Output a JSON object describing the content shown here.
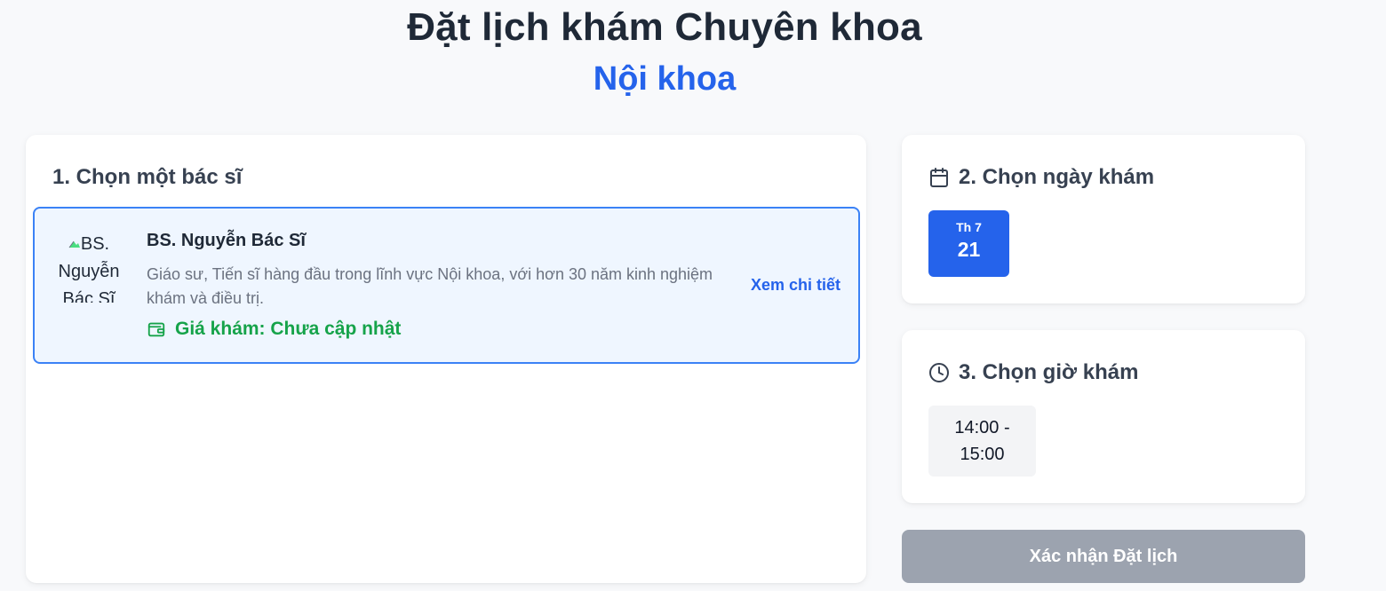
{
  "header": {
    "title": "Đặt lịch khám Chuyên khoa",
    "subtitle": "Nội khoa"
  },
  "step1": {
    "title": "1. Chọn một bác sĩ",
    "doctor": {
      "photo_alt_line1": "BS.",
      "photo_alt_line2": "Nguyễn",
      "photo_alt_line3": "Bác Sĩ",
      "name": "BS. Nguyễn Bác Sĩ",
      "description": "Giáo sư, Tiến sĩ hàng đầu trong lĩnh vực Nội khoa, với hơn 30 năm kinh nghiệm khám và điều trị.",
      "price_label": "Giá khám: Chưa cập nhật",
      "detail_link": "Xem chi tiết",
      "selected": true
    }
  },
  "step2": {
    "title": "2. Chọn ngày khám",
    "icon": "calendar-icon",
    "dates": [
      {
        "weekday": "Th 7",
        "day": "21",
        "selected": true
      }
    ]
  },
  "step3": {
    "title": "3. Chọn giờ khám",
    "icon": "clock-icon",
    "slots": [
      {
        "line1": "14:00 -",
        "line2": "15:00"
      }
    ]
  },
  "confirm_button": "Xác nhận Đặt lịch",
  "colors": {
    "accent": "#2563eb",
    "success": "#16a34a",
    "selected_bg": "#eff6ff",
    "disabled_button": "#9ca3af"
  }
}
